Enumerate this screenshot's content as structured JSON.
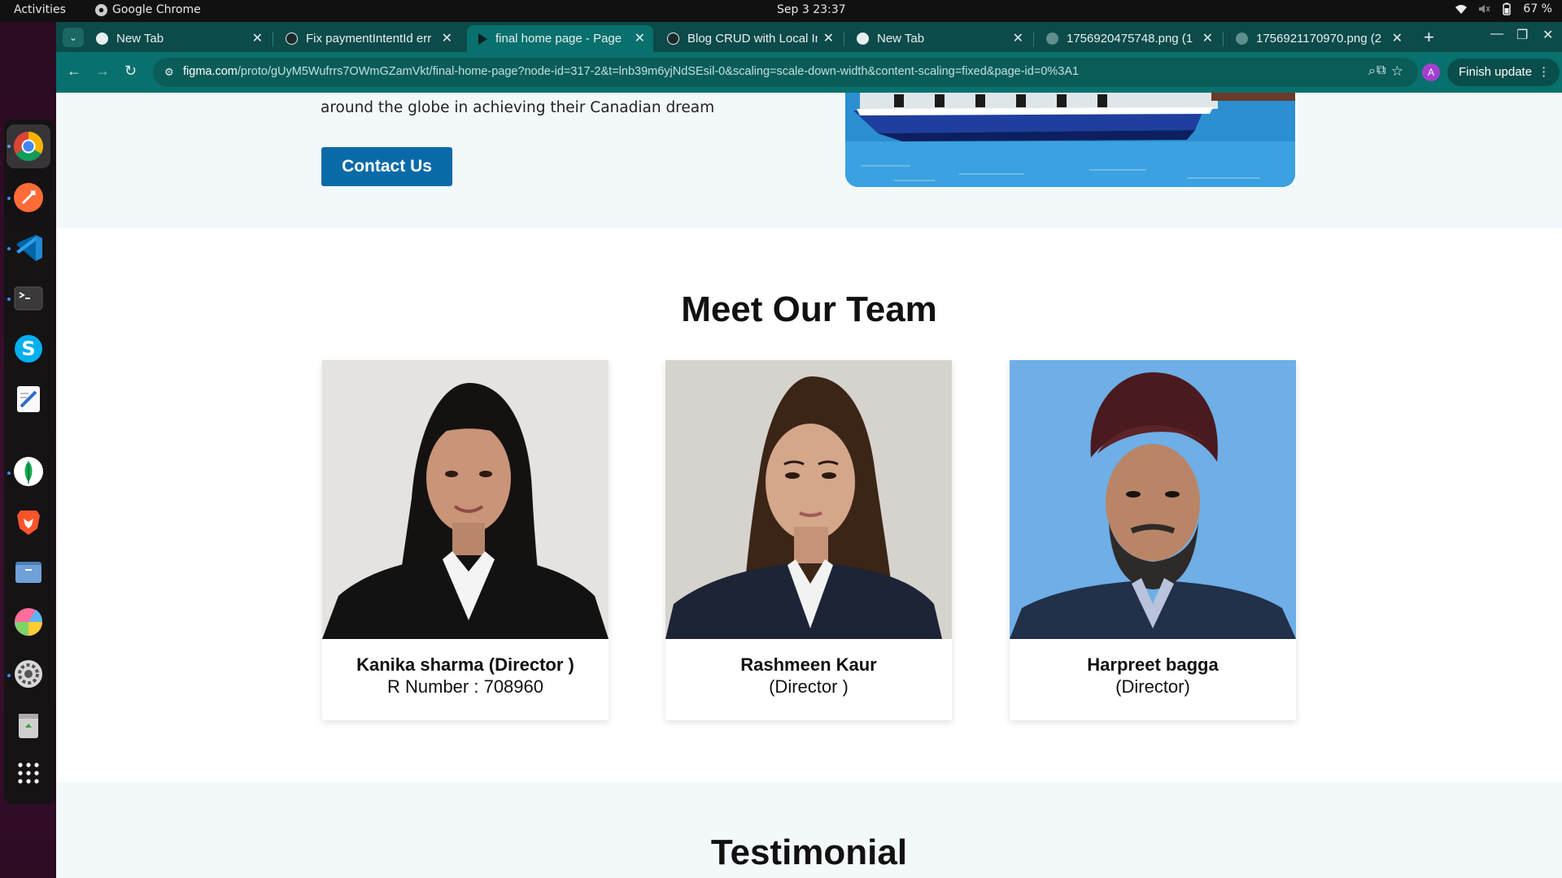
{
  "system_bar": {
    "activities": "Activities",
    "app_name": "Google Chrome",
    "clock": "Sep 3  23:37",
    "battery": "67 %"
  },
  "browser": {
    "tabs": [
      {
        "title": "New Tab",
        "active": false,
        "favicon": "chrome-icon"
      },
      {
        "title": "Fix paymentIntentId err",
        "active": false,
        "favicon": "openai-icon"
      },
      {
        "title": "final home page - Page",
        "active": true,
        "favicon": "figma-play-icon"
      },
      {
        "title": "Blog CRUD with Local In",
        "active": false,
        "favicon": "openai-icon"
      },
      {
        "title": "New Tab",
        "active": false,
        "favicon": "chrome-icon"
      },
      {
        "title": "1756920475748.png (1",
        "active": false,
        "favicon": "globe-icon"
      },
      {
        "title": "1756921170970.png (2",
        "active": false,
        "favicon": "globe-icon"
      }
    ],
    "url_domain": "figma.com",
    "url_path": "/proto/gUyM5Wufrrs7OWmGZamVkt/final-home-page?node-id=317-2&t=lnb39m6yjNdSEsil-0&scaling=scale-down-width&content-scaling=fixed&page-id=0%3A1",
    "profile_initial": "A",
    "finish_update": "Finish update"
  },
  "page": {
    "hero_text": "around the globe in achieving their Canadian dream",
    "contact_button": "Contact Us",
    "team_heading": "Meet Our Team",
    "team": [
      {
        "name": "Kanika sharma (Director )",
        "sub": "R Number : 708960"
      },
      {
        "name": "Rashmeen Kaur",
        "sub": "(Director )"
      },
      {
        "name": "Harpreet bagga",
        "sub": "(Director)"
      }
    ],
    "testimonial_heading": "Testimonial"
  },
  "colors": {
    "chrome_tabstrip": "#0d4a4a",
    "chrome_toolbar": "#08706d",
    "contact_button": "#0a6aa8",
    "hero_bg": "#f3f8fb"
  }
}
